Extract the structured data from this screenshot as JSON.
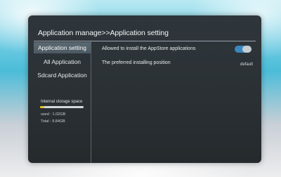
{
  "header": {
    "title": "Application manage>>Application setting"
  },
  "sidebar": {
    "items": [
      {
        "label": "Application setting",
        "active": true
      },
      {
        "label": "All Application",
        "active": false
      },
      {
        "label": "Sdcard Application",
        "active": false
      }
    ],
    "storage": {
      "label": "Internal storage space",
      "used": "used : 1.02GB",
      "total": "Total : 9.84GB",
      "used_fraction": 0.104,
      "fill_color": "#e7c21f"
    }
  },
  "settings": [
    {
      "label": "Allowed to install the AppStore applications",
      "toggle_on": true,
      "toggle_color": "#3b88bf"
    },
    {
      "label": "The preferred installing position",
      "value": "default"
    }
  ]
}
